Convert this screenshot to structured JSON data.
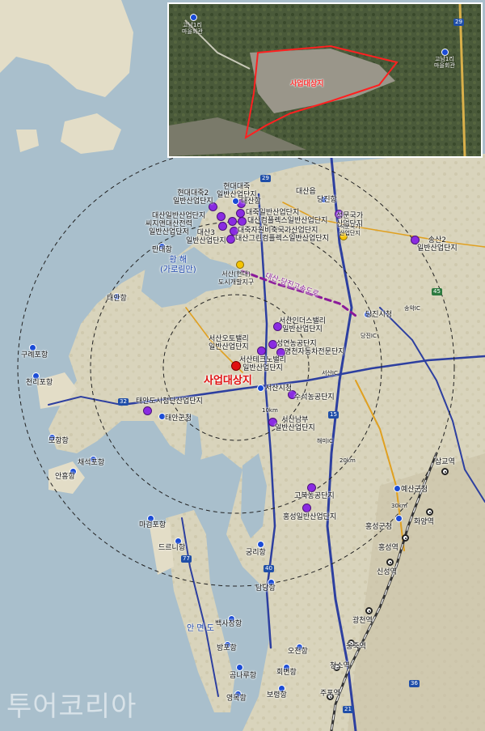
{
  "site_label": "사업대상지",
  "inset": {
    "site_label": "사업대상지",
    "place_1": "고남1리\n마을회관",
    "place_2": "고남1리\n마을회관",
    "route": "29"
  },
  "areas": {
    "sea": "황 해\n(가로림만)",
    "anmyeon": "안 면 도"
  },
  "expressway": "대산-당진고속도로",
  "ring_labels": [
    "10km",
    "20km",
    "30km"
  ],
  "industrial": [
    {
      "id": "hyundai2",
      "label": "현대대죽2\n일반산업단지"
    },
    {
      "id": "hyundai",
      "label": "현대대죽\n일반산업단지"
    },
    {
      "id": "daesan",
      "label": "대산일반산업단지"
    },
    {
      "id": "daejuk",
      "label": "대죽일반산업단지"
    },
    {
      "id": "ssizi",
      "label": "씨지앤대산전력\n일반산업단지"
    },
    {
      "id": "daesan3",
      "label": "대산3\n일반산업단지"
    },
    {
      "id": "complex",
      "label": "대산컴플렉스일반산업단지"
    },
    {
      "id": "jawon",
      "label": "대죽자원비축국가산업단지"
    },
    {
      "id": "green",
      "label": "대산그린컴플렉스일반산업단지"
    },
    {
      "id": "seokmun",
      "label": "석문국가\n산업단지"
    },
    {
      "id": "songsan",
      "label": "송산2\n일반산업단지"
    },
    {
      "id": "industrial_valley",
      "label": "서산인더스밸리\n일반산업단지"
    },
    {
      "id": "auto_valley",
      "label": "서산오토밸리\n일반산업단지"
    },
    {
      "id": "seongyeon",
      "label": "성연농공단지"
    },
    {
      "id": "myeongcheon",
      "label": "명천자동차전문단지"
    },
    {
      "id": "techno",
      "label": "서산테크노밸리\n일반산업단지"
    },
    {
      "id": "suseok",
      "label": "수석농공단지"
    },
    {
      "id": "nambu",
      "label": "서산남부\n일반산업단지"
    },
    {
      "id": "taean",
      "label": "태안도시첨단산업단지"
    },
    {
      "id": "gobuk",
      "label": "고북농공단지"
    },
    {
      "id": "hongseong",
      "label": "홍성일반산업단지"
    }
  ],
  "places": [
    {
      "id": "daesanhang",
      "label": "대산항"
    },
    {
      "id": "daesan_up",
      "label": "대산읍"
    },
    {
      "id": "dangjinhang",
      "label": "당진항"
    },
    {
      "id": "seokmun_gukga",
      "label": "석문국가\n산업단지"
    },
    {
      "id": "hyundai_city",
      "label": "서산(현대)\n도시개발지구"
    },
    {
      "id": "dangjin_city",
      "label": "당진시청"
    },
    {
      "id": "seosan_city",
      "label": "서산시청"
    },
    {
      "id": "taean_county",
      "label": "태안군청"
    },
    {
      "id": "hongseong_county",
      "label": "홍성군청"
    },
    {
      "id": "yesan_county",
      "label": "예산군청"
    },
    {
      "id": "minaehang",
      "label": "만대항"
    },
    {
      "id": "taeanhang",
      "label": "태안항"
    },
    {
      "id": "gurwanhang",
      "label": "구례포항"
    },
    {
      "id": "chollipohang",
      "label": "천리포항"
    },
    {
      "id": "mohang",
      "label": "모항항"
    },
    {
      "id": "chaeseok",
      "label": "채석포항"
    },
    {
      "id": "anheunghang",
      "label": "안흥항"
    },
    {
      "id": "magum",
      "label": "마검포항"
    },
    {
      "id": "deurenhang",
      "label": "드르니항"
    },
    {
      "id": "gungrihang",
      "label": "궁리항"
    },
    {
      "id": "namdanghang",
      "label": "남당항"
    },
    {
      "id": "baeksajang",
      "label": "백사장항"
    },
    {
      "id": "bangpo",
      "label": "방포항"
    },
    {
      "id": "yeongmok",
      "label": "영목항"
    },
    {
      "id": "ocheon",
      "label": "오천항"
    },
    {
      "id": "hoebyeon",
      "label": "회변항"
    },
    {
      "id": "bobong",
      "label": "보령항"
    },
    {
      "id": "gomnaru",
      "label": "곰나루항"
    },
    {
      "id": "sapgyo",
      "label": "삽교역"
    },
    {
      "id": "hwayang",
      "label": "화양역"
    },
    {
      "id": "hongseong_st",
      "label": "홍성역"
    },
    {
      "id": "sinseong",
      "label": "신성역"
    },
    {
      "id": "gwangcheon",
      "label": "광천역"
    },
    {
      "id": "ungjuk",
      "label": "웅죽역"
    },
    {
      "id": "cheongso",
      "label": "청소역"
    },
    {
      "id": "jupo",
      "label": "주포역"
    },
    {
      "id": "dangjin_ic",
      "label": "당진IC"
    },
    {
      "id": "seosan_ic",
      "label": "서산IC"
    },
    {
      "id": "haemi_ic",
      "label": "해미IC"
    },
    {
      "id": "songak_ic",
      "label": "송악IC"
    }
  ],
  "road_shields": [
    "29",
    "32",
    "15",
    "40",
    "77",
    "21",
    "45",
    "36"
  ],
  "watermark": "투어코리아",
  "colors": {
    "industrial": "#8a2be2",
    "place": "#1a4bd6",
    "site": "#e01010",
    "expressway": "#8a1a9a",
    "ring": "#222222"
  }
}
